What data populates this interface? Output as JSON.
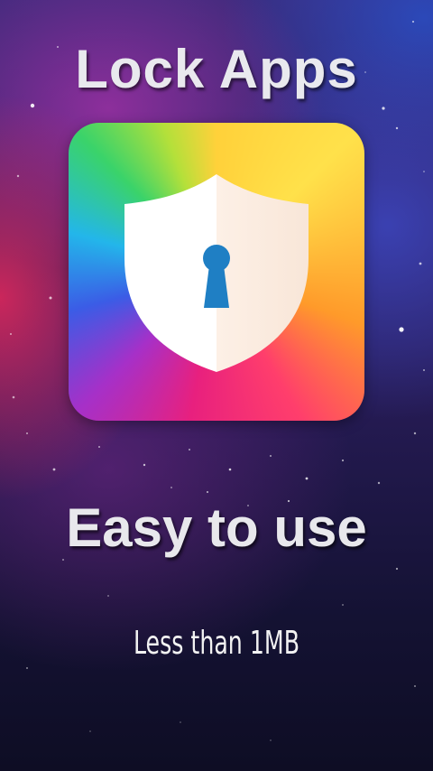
{
  "screen": {
    "title": "Lock Apps",
    "headline": "Easy to use",
    "subtitle": "Less than 1MB"
  },
  "icon": {
    "name": "shield-keyhole-icon",
    "keyhole_color": "#1f7fc4"
  }
}
